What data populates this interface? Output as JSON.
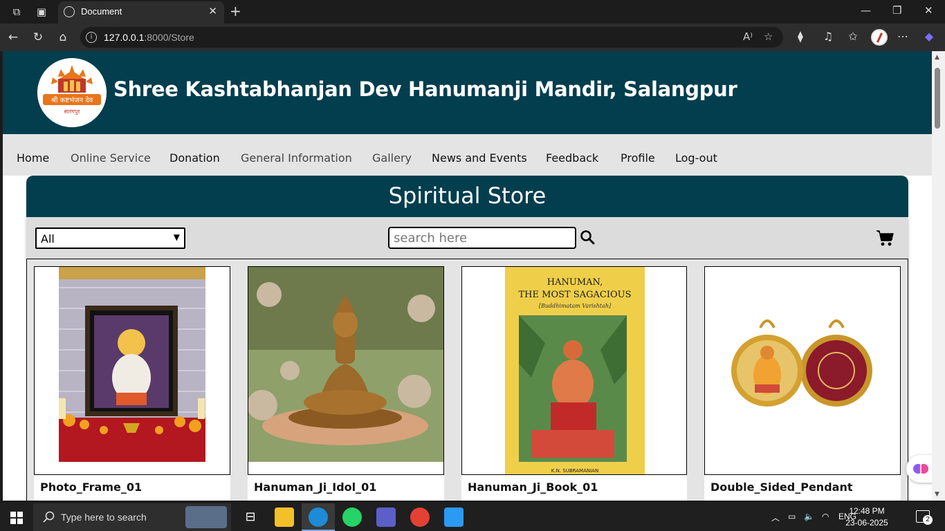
{
  "browser": {
    "tab_title": "Document",
    "url_host": "127.0.0.1",
    "url_path": ":8000/Store"
  },
  "site": {
    "title": "Shree Kashtabhanjan Dev Hanumanji Mandir, Salangpur",
    "logo_text_top": "श्री कष्टभंजन देव",
    "logo_text_bottom": "सारंगपुर"
  },
  "nav": {
    "items": [
      "Home",
      "Online Service",
      "Donation",
      "General Information",
      "Gallery",
      "News and Events",
      "Feedback",
      "Profile",
      "Log-out"
    ]
  },
  "store": {
    "title": "Spiritual Store",
    "category_selected": "All",
    "search_placeholder": "search here"
  },
  "products": [
    {
      "name": "Photo_Frame_01"
    },
    {
      "name": "Hanuman_Ji_Idol_01"
    },
    {
      "name": "Hanuman_Ji_Book_01",
      "cover_title_1": "HANUMAN,",
      "cover_title_2": "THE MOST SAGACIOUS",
      "cover_subtitle": "[Buddhimatam Varishtah]",
      "cover_author": "K.N. SUBRAMANIAN"
    },
    {
      "name": "Double_Sided_Pendant"
    }
  ],
  "taskbar": {
    "search_text": "Type here to search",
    "lang": "ENG",
    "time": "12:48 PM",
    "date": "23-06-2025",
    "notif_count": "2"
  }
}
